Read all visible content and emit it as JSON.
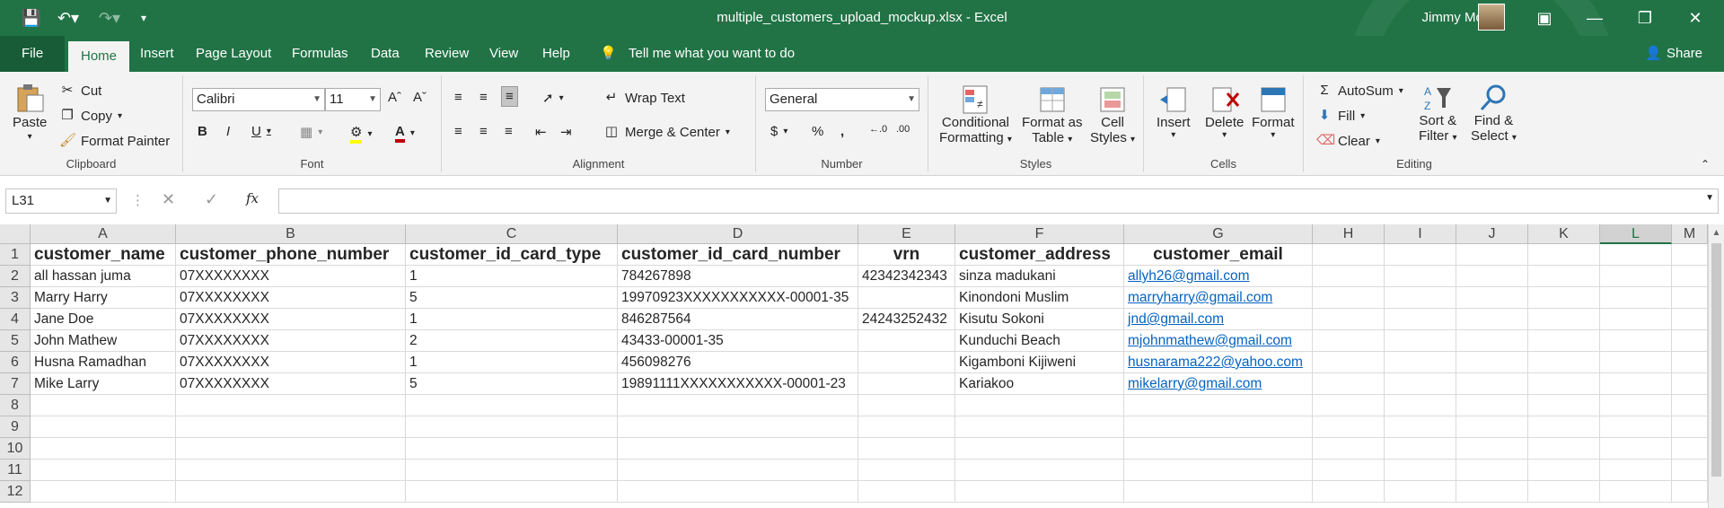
{
  "app": {
    "title": "multiple_customers_upload_mockup.xlsx  -  Excel",
    "user": "Jimmy Mchau",
    "share": "Share"
  },
  "tabs": [
    "File",
    "Home",
    "Insert",
    "Page Layout",
    "Formulas",
    "Data",
    "Review",
    "View",
    "Help"
  ],
  "tell_me": "Tell me what you want to do",
  "ribbon": {
    "clipboard": {
      "paste": "Paste",
      "cut": "Cut",
      "copy": "Copy",
      "format_painter": "Format Painter",
      "label": "Clipboard"
    },
    "font": {
      "name": "Calibri",
      "size": "11",
      "label": "Font"
    },
    "alignment": {
      "wrap": "Wrap Text",
      "merge": "Merge & Center",
      "label": "Alignment"
    },
    "number": {
      "format": "General",
      "label": "Number"
    },
    "styles": {
      "conditional": "Conditional",
      "formatting": "Formatting",
      "format_as": "Format as",
      "table": "Table",
      "cell": "Cell",
      "cell_styles": "Styles",
      "label": "Styles"
    },
    "cells": {
      "insert": "Insert",
      "delete": "Delete",
      "format": "Format",
      "label": "Cells"
    },
    "editing": {
      "autosum": "AutoSum",
      "fill": "Fill",
      "clear": "Clear",
      "sort": "Sort &",
      "filter": "Filter",
      "find": "Find &",
      "select": "Select",
      "label": "Editing"
    }
  },
  "name_box": "L31",
  "columns": [
    "A",
    "B",
    "C",
    "D",
    "E",
    "F",
    "G",
    "H",
    "I",
    "J",
    "K",
    "L",
    "M"
  ],
  "rows": [
    "1",
    "2",
    "3",
    "4",
    "5",
    "6",
    "7",
    "8",
    "9",
    "10",
    "11",
    "12"
  ],
  "sheet": {
    "headers": [
      "customer_name",
      "customer_phone_number",
      "customer_id_card_type",
      "customer_id_card_number",
      "vrn",
      "customer_address",
      "customer_email"
    ],
    "data": [
      [
        "all hassan juma",
        "07XXXXXXXX",
        "1",
        "784267898",
        "42342342343",
        "sinza madukani",
        "allyh26@gmail.com"
      ],
      [
        "Marry Harry",
        "07XXXXXXXX",
        "5",
        "19970923XXXXXXXXXXX-00001-35",
        "",
        "Kinondoni Muslim",
        "marryharry@gmail.com"
      ],
      [
        "Jane Doe",
        "07XXXXXXXX",
        "1",
        "846287564",
        "24243252432",
        "Kisutu Sokoni",
        "jnd@gmail.com"
      ],
      [
        "John Mathew",
        "07XXXXXXXX",
        "2",
        "43433-00001-35",
        "",
        "Kunduchi Beach",
        "mjohnmathew@gmail.com"
      ],
      [
        "Husna Ramadhan",
        "07XXXXXXXX",
        "1",
        "456098276",
        "",
        "Kigamboni Kijiweni",
        "husnarama222@yahoo.com"
      ],
      [
        "Mike Larry",
        "07XXXXXXXX",
        "5",
        "19891111XXXXXXXXXXX-00001-23",
        "",
        "Kariakoo",
        "mikelarry@gmail.com"
      ]
    ]
  },
  "colors": {
    "accent": "#217346",
    "link": "#0563c1"
  }
}
